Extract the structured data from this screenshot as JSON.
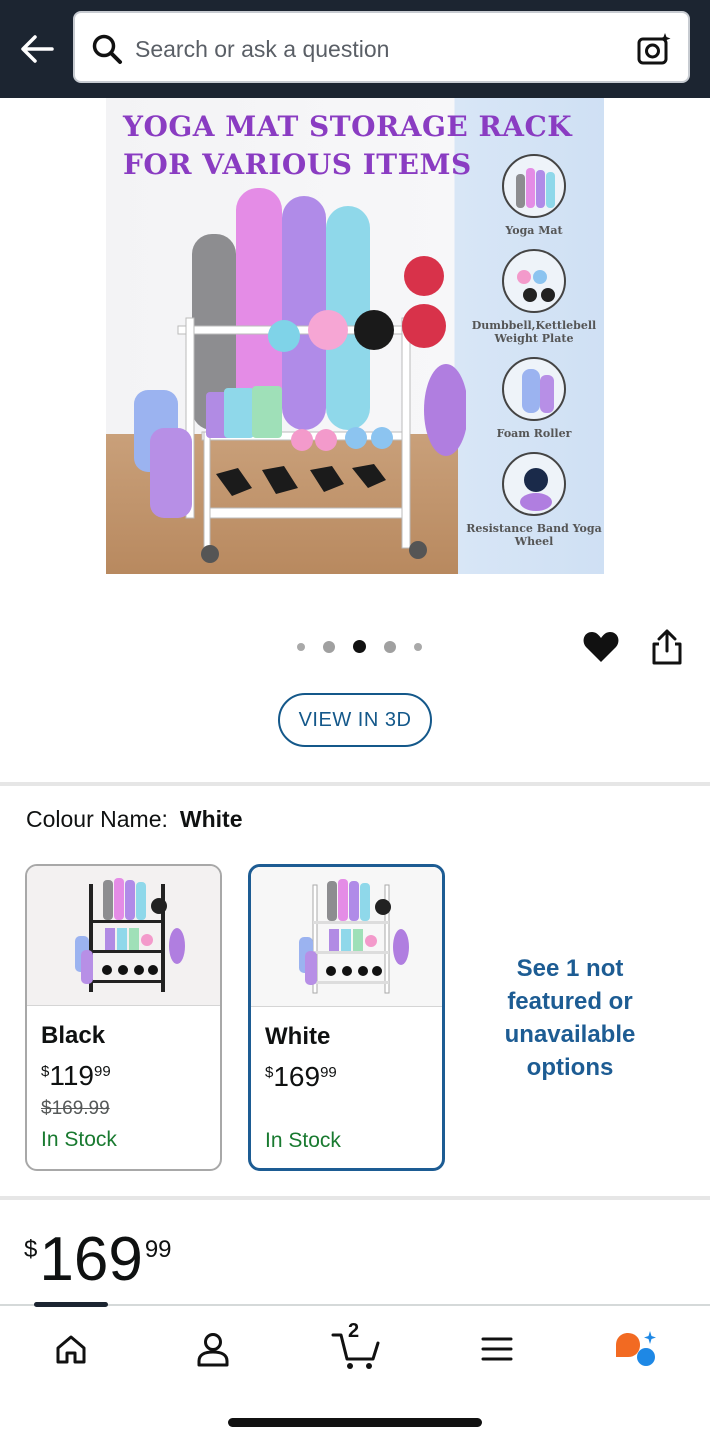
{
  "header": {
    "search_placeholder": "Search or ask a question"
  },
  "product_image": {
    "title_line1": "YOGA MAT STORAGE RACK",
    "title_line2": "FOR VARIOUS ITEMS",
    "features": [
      {
        "label": "Yoga Mat"
      },
      {
        "label": "Dumbbell,Kettlebell Weight Plate"
      },
      {
        "label": "Foam Roller"
      },
      {
        "label": "Resistance Band Yoga Wheel"
      }
    ],
    "carousel_count": 5,
    "carousel_active_index": 2
  },
  "view_3d_label": "VIEW IN 3D",
  "colour": {
    "label": "Colour Name:",
    "selected_value": "White",
    "options": [
      {
        "name": "Black",
        "price_whole": "119",
        "price_fraction": "99",
        "list_price": "$169.99",
        "stock": "In Stock",
        "selected": false
      },
      {
        "name": "White",
        "price_whole": "169",
        "price_fraction": "99",
        "list_price": "",
        "stock": "In Stock",
        "selected": true
      }
    ],
    "see_more": "See 1 not featured or unavailable options"
  },
  "price": {
    "currency": "$",
    "whole": "169",
    "fraction": "99"
  },
  "bottom_nav": {
    "cart_count": "2",
    "items": [
      "home-icon",
      "account-icon",
      "cart-icon",
      "menu-icon",
      "rufus-icon"
    ]
  },
  "colors": {
    "header_bg": "#1c2531",
    "link_blue": "#1d5c93",
    "in_stock_green": "#197a30",
    "title_purple": "#8a3cc2"
  }
}
